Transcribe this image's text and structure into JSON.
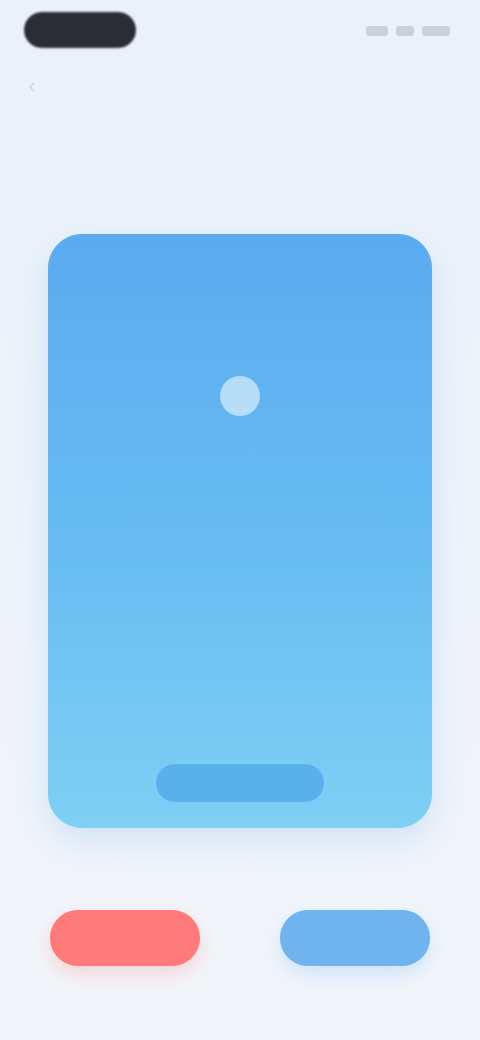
{
  "status_bar": {
    "time": "",
    "icons": [
      "signal-icon",
      "wifi-icon",
      "battery-icon"
    ]
  },
  "nav": {
    "back_icon": "chevron-left-icon",
    "title": ""
  },
  "card": {
    "icon": "circle-icon",
    "label": "",
    "button_label": "",
    "gradient_top": "#5aabf0",
    "gradient_bottom": "#7fd0f4"
  },
  "actions": {
    "left_label": "",
    "left_color": "#ff7b7b",
    "right_label": "",
    "right_color": "#6fb4ee"
  }
}
